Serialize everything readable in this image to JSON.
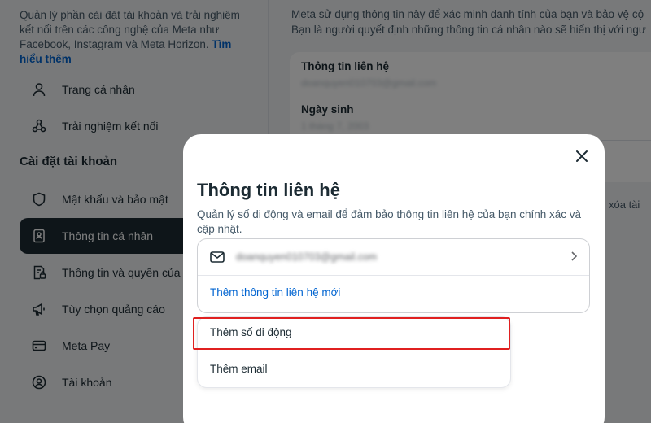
{
  "sidebar": {
    "intro_text": "Quản lý phần cài đặt tài khoản và trải nghiệm kết nối trên các công nghệ của Meta như Facebook, Instagram và Meta Horizon.",
    "intro_link": "Tìm hiểu thêm",
    "items_top": [
      {
        "label": "Trang cá nhân",
        "icon": "person-icon"
      },
      {
        "label": "Trải nghiệm kết nối",
        "icon": "connected-experiences-icon"
      }
    ],
    "section_heading": "Cài đặt tài khoản",
    "items": [
      {
        "label": "Mật khẩu và bảo mật",
        "icon": "shield-icon"
      },
      {
        "label": "Thông tin cá nhân",
        "icon": "id-card-icon",
        "active": true
      },
      {
        "label": "Thông tin và quyền của b",
        "icon": "document-lock-icon"
      },
      {
        "label": "Tùy chọn quảng cáo",
        "icon": "megaphone-icon"
      },
      {
        "label": "Meta Pay",
        "icon": "credit-card-icon"
      },
      {
        "label": "Tài khoản",
        "icon": "account-circle-icon"
      }
    ]
  },
  "main": {
    "description_line1": "Meta sử dụng thông tin này để xác minh danh tính của bạn và bảo vệ cộ",
    "description_line2": "Bạn là người quyết định những thông tin cá nhân nào sẽ hiển thị với ngư",
    "contact_label": "Thông tin liên hệ",
    "contact_value": "doanquyen010703@gmail.com",
    "birthday_label": "Ngày sinh",
    "birthday_value": "1 tháng 7, 2003",
    "delete_text": "xóa tài"
  },
  "modal": {
    "title": "Thông tin liên hệ",
    "description": "Quản lý số di động và email để đảm bảo thông tin liên hệ của bạn chính xác và cập nhật.",
    "email": "doanquyen010703@gmail.com",
    "add_new_label": "Thêm thông tin liên hệ mới",
    "options": [
      "Thêm số di động",
      "Thêm email"
    ]
  },
  "colors": {
    "accent": "#0064d1",
    "highlight": "#e02020",
    "active_nav": "#1c2b33"
  }
}
